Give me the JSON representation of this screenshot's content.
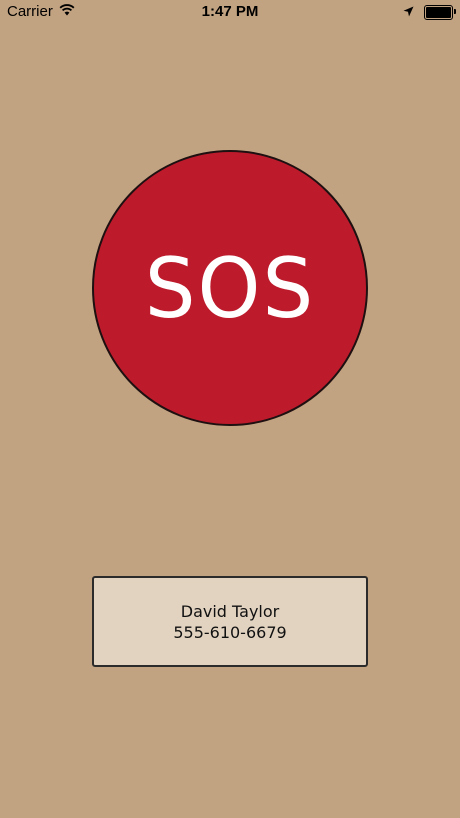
{
  "status_bar": {
    "carrier": "Carrier",
    "time": "1:47 PM",
    "icons": [
      "wifi-icon",
      "location-arrow-icon",
      "battery-icon"
    ],
    "battery_level": 1.0
  },
  "sos_button": {
    "label": "SOS",
    "color": "#bd1b2c"
  },
  "contact": {
    "name": "David Taylor",
    "phone": "555-610-6679"
  },
  "colors": {
    "background": "#c2a381",
    "card_background": "#e2d3c1",
    "sos_red": "#bd1b2c"
  }
}
